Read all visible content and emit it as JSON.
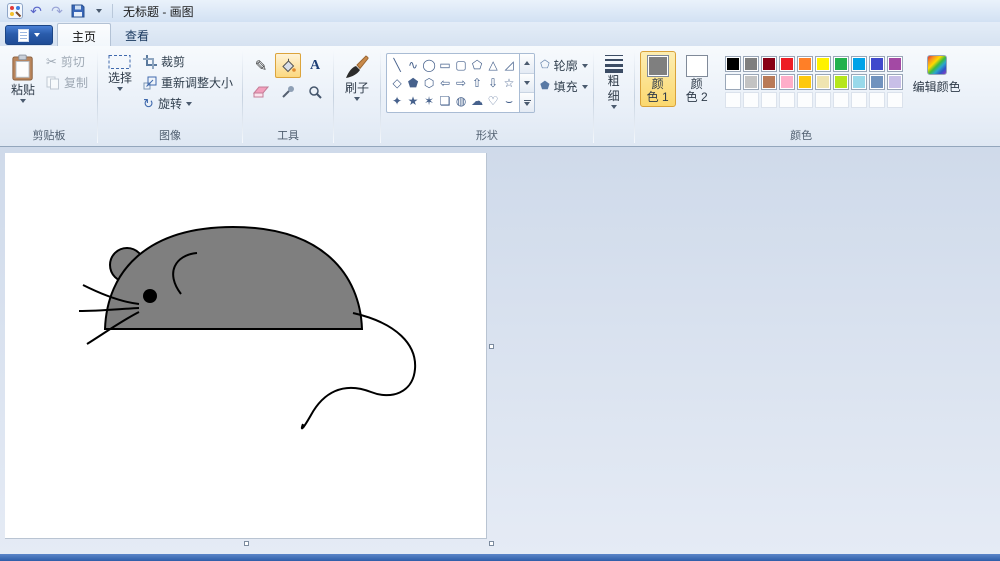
{
  "titlebar": {
    "title": "无标题 - 画图"
  },
  "tabs": {
    "home": "主页",
    "view": "查看"
  },
  "icons": {
    "undo": "↶",
    "redo": "↷",
    "cut": "✂",
    "pencil": "✎",
    "text_tool": "A",
    "rotate": "↻",
    "outline_shape": "⬠",
    "fill_shape": "⬟"
  },
  "clipboard": {
    "label": "剪贴板",
    "paste": "粘贴",
    "cut": "剪切",
    "copy": "复制"
  },
  "image": {
    "label": "图像",
    "select": "选择",
    "crop": "裁剪",
    "resize": "重新调整大小",
    "rotate": "旋转"
  },
  "tools": {
    "label": "工具"
  },
  "brushes": {
    "label": "刷子"
  },
  "shapes": {
    "label": "形状",
    "outline": "轮廓",
    "fill": "填充",
    "glyphs": [
      "╲",
      "∿",
      "◯",
      "▭",
      "▢",
      "⬠",
      "△",
      "◿",
      "◇",
      "⬟",
      "⬡",
      "⇦",
      "⇨",
      "⇧",
      "⇩",
      "☆",
      "✦",
      "★",
      "✶",
      "❏",
      "◍",
      "☁",
      "♡",
      "⌣"
    ]
  },
  "size": {
    "line1": "粗",
    "line2": "细"
  },
  "colors": {
    "label": "颜色",
    "color1_line1": "颜",
    "color1_line2": "色 1",
    "color2_line1": "颜",
    "color2_line2": "色 2",
    "edit_label": "编辑颜色",
    "color1": "#7f7f7f",
    "color2": "#ffffff",
    "palette": [
      [
        "#000000",
        "#7f7f7f",
        "#880015",
        "#ed1c24",
        "#ff7f27",
        "#fff200",
        "#22b14c",
        "#00a2e8",
        "#3f48cc",
        "#a349a4"
      ],
      [
        "#ffffff",
        "#c3c3c3",
        "#b97a57",
        "#ffaec9",
        "#ffc90e",
        "#efe4b0",
        "#b5e61d",
        "#99d9ea",
        "#7092be",
        "#c8bfe7"
      ],
      [
        null,
        null,
        null,
        null,
        null,
        null,
        null,
        null,
        null,
        null
      ]
    ]
  },
  "drawing": {
    "body_color": "#7f7f7f",
    "outline_color": "#000000"
  }
}
